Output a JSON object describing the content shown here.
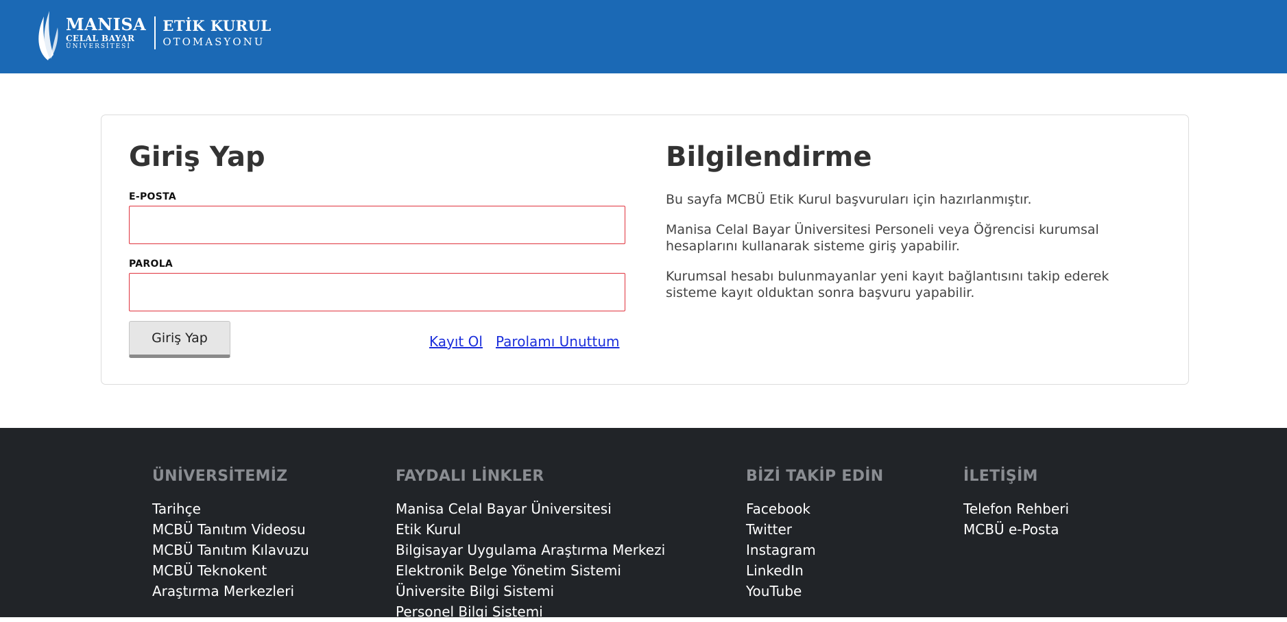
{
  "header": {
    "logo": {
      "line1": "MANISA",
      "line2": "CELAL BAYAR",
      "line3": "ÜNİVERSİTESİ",
      "app_line1": "ETİK KURUL",
      "app_line2": "OTOMASYONU"
    }
  },
  "login": {
    "title": "Giriş Yap",
    "email_label": "E-POSTA",
    "email_value": "",
    "password_label": "PAROLA",
    "password_value": "",
    "submit_label": "Giriş Yap",
    "register_link": "Kayıt Ol",
    "forgot_link": "Parolamı Unuttum",
    "error_border_color": "#e0323c"
  },
  "info": {
    "title": "Bilgilendirme",
    "p1": "Bu sayfa MCBÜ Etik Kurul başvuruları için hazırlanmıştır.",
    "p2": "Manisa Celal Bayar Üniversitesi Personeli veya Öğrencisi kurumsal hesaplarını kullanarak sisteme giriş yapabilir.",
    "p3": "Kurumsal hesabı bulunmayanlar yeni kayıt bağlantısını takip ederek sisteme kayıt olduktan sonra başvuru yapabilir."
  },
  "footer": {
    "columns": [
      {
        "title": "ÜNİVERSİTEMİZ",
        "links": [
          "Tarihçe",
          "MCBÜ Tanıtım Videosu",
          "MCBÜ Tanıtım Kılavuzu",
          "MCBÜ Teknokent",
          "Araştırma Merkezleri"
        ]
      },
      {
        "title": "FAYDALI LİNKLER",
        "links": [
          "Manisa Celal Bayar Üniversitesi",
          "Etik Kurul",
          "Bilgisayar Uygulama Araştırma Merkezi",
          "Elektronik Belge Yönetim Sistemi",
          "Üniversite Bilgi Sistemi",
          "Personel Bilgi Sistemi"
        ]
      },
      {
        "title": "BİZİ TAKİP EDİN",
        "links": [
          "Facebook",
          "Twitter",
          "Instagram",
          "LinkedIn",
          "YouTube"
        ]
      },
      {
        "title": "İLETİŞİM",
        "links": [
          "Telefon Rehberi",
          "MCBÜ e-Posta"
        ]
      }
    ]
  },
  "colors": {
    "header_bg": "#1b69b5",
    "footer_bg": "#212428",
    "link": "#1a2ddb"
  }
}
